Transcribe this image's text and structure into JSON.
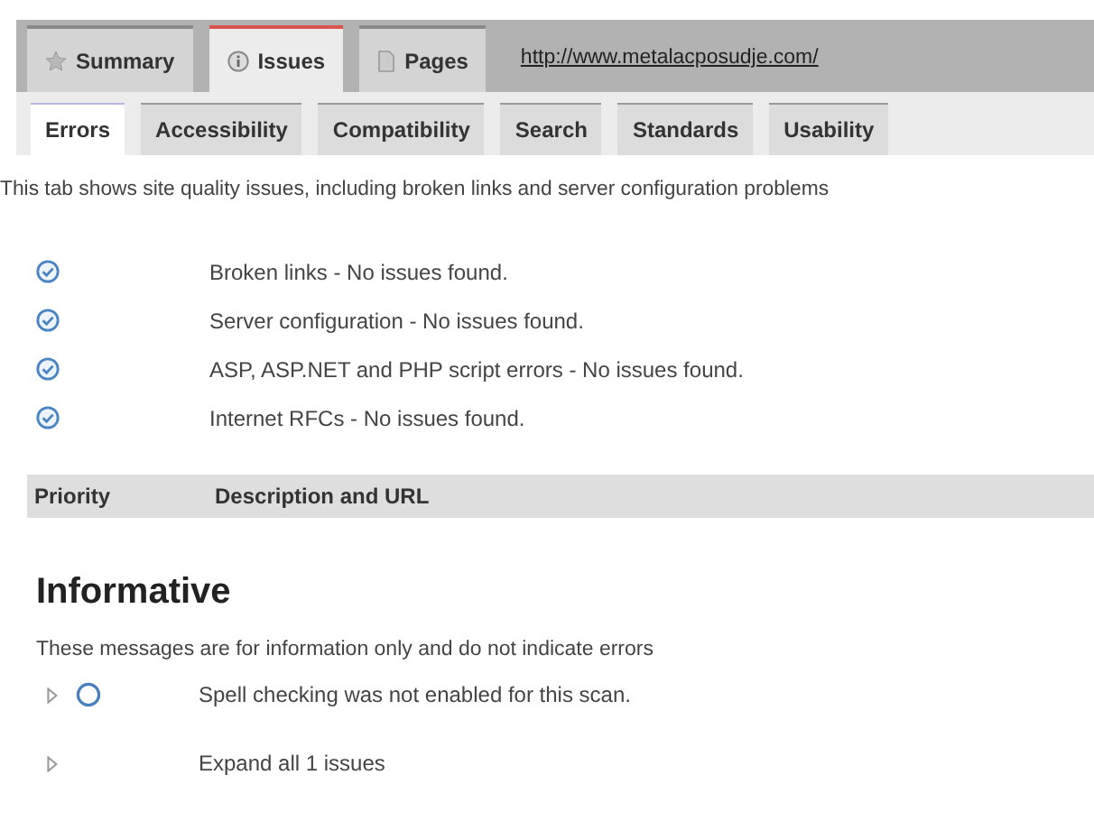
{
  "main_tabs": [
    {
      "label": "Summary",
      "kind": "star",
      "selected": false
    },
    {
      "label": "Issues",
      "kind": "info",
      "selected": true
    },
    {
      "label": "Pages",
      "kind": "page",
      "selected": false
    }
  ],
  "url": "http://www.metalacposudje.com/",
  "sub_tabs": [
    {
      "label": "Errors",
      "selected": true
    },
    {
      "label": "Accessibility",
      "selected": false
    },
    {
      "label": "Compatibility",
      "selected": false
    },
    {
      "label": "Search",
      "selected": false
    },
    {
      "label": "Standards",
      "selected": false
    },
    {
      "label": "Usability",
      "selected": false
    }
  ],
  "intro": "This tab shows site quality issues, including broken links and server configuration problems",
  "checks": [
    {
      "text": "Broken links - No issues found."
    },
    {
      "text": "Server configuration - No issues found."
    },
    {
      "text": "ASP, ASP.NET and PHP script errors - No issues found."
    },
    {
      "text": "Internet RFCs - No issues found."
    }
  ],
  "table": {
    "columns": [
      "Priority",
      "Description and URL"
    ]
  },
  "informative": {
    "heading": "Informative",
    "description": "These messages are for information only and do not indicate errors",
    "items": [
      {
        "kind": "issue",
        "text": "Spell checking was not enabled for this scan."
      },
      {
        "kind": "expand",
        "text": "Expand all 1 issues"
      }
    ]
  }
}
